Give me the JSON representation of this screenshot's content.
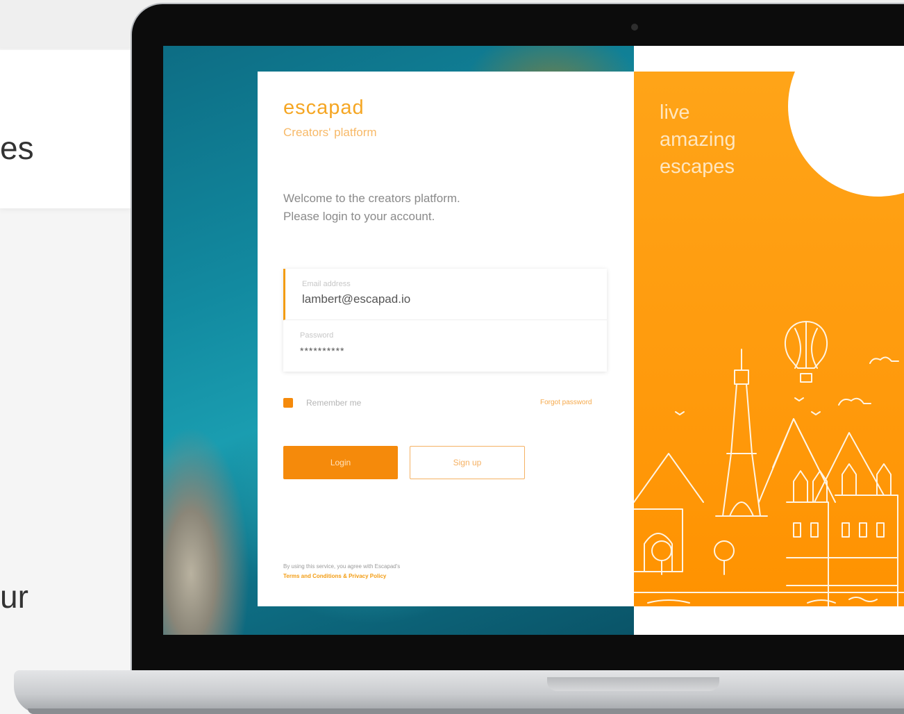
{
  "background": {
    "fragment_top": "es",
    "fragment_bottom": "ur"
  },
  "login": {
    "brand": "escapad",
    "subtitle": "Creators' platform",
    "welcome_line1": "Welcome to the creators platform.",
    "welcome_line2": "Please login to your account.",
    "email_label": "Email address",
    "email_value": "lambert@escapad.io",
    "password_label": "Password",
    "password_value": "**********",
    "remember_label": "Remember me",
    "remember_checked": true,
    "forgot_label": "Forgot password",
    "login_button": "Login",
    "signup_button": "Sign up",
    "legal_line1": "By using this service, you agree with Escapad's",
    "legal_line2": "Terms and Conditions & Privacy Policy"
  },
  "promo": {
    "tagline_line1": "live",
    "tagline_line2": "amazing",
    "tagline_line3": "escapes"
  },
  "colors": {
    "accent": "#f58a0b",
    "brand": "#f5a623",
    "promo_background": "#ff9a0c",
    "ocean": "#128aa0"
  },
  "icons": {
    "checkbox": "checkbox-checked-icon",
    "illustration": "city-skyline-illustration"
  }
}
